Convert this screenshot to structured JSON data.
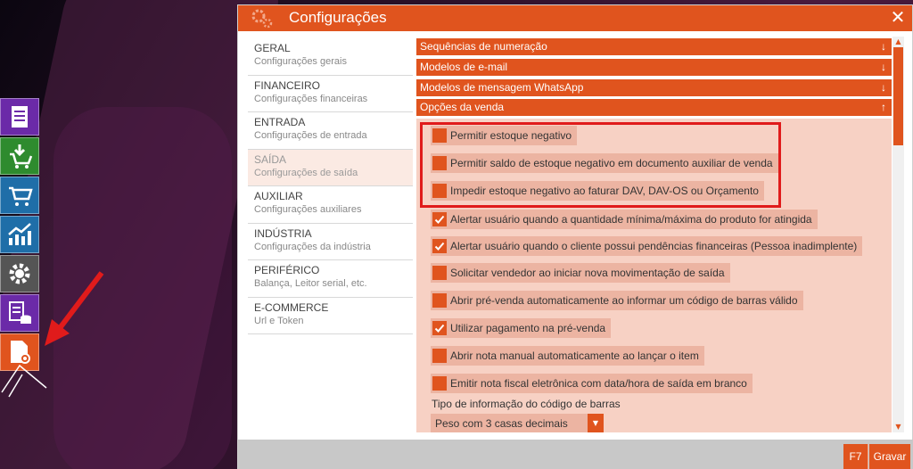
{
  "window": {
    "title": "Configurações"
  },
  "nav": [
    {
      "title": "GERAL",
      "subtitle": "Configurações gerais"
    },
    {
      "title": "FINANCEIRO",
      "subtitle": "Configurações financeiras"
    },
    {
      "title": "ENTRADA",
      "subtitle": "Configurações de entrada"
    },
    {
      "title": "SAÍDA",
      "subtitle": "Configurações de saída"
    },
    {
      "title": "AUXILIAR",
      "subtitle": "Configurações auxiliares"
    },
    {
      "title": "INDÚSTRIA",
      "subtitle": "Configurações da indústria"
    },
    {
      "title": "PERIFÉRICO",
      "subtitle": "Balança, Leitor serial, etc."
    },
    {
      "title": "E-COMMERCE",
      "subtitle": "Url e Token"
    }
  ],
  "sections": [
    {
      "label": "Sequências de numeração",
      "icon": "arrow-down-icon"
    },
    {
      "label": "Modelos de e-mail",
      "icon": "arrow-down-icon"
    },
    {
      "label": "Modelos de mensagem WhatsApp",
      "icon": "arrow-down-icon"
    },
    {
      "label": "Opções da venda",
      "icon": "arrow-up-icon"
    }
  ],
  "options": [
    {
      "label": "Permitir estoque negativo",
      "checked": false
    },
    {
      "label": "Permitir saldo de estoque negativo em documento auxiliar de venda",
      "checked": false
    },
    {
      "label": "Impedir estoque negativo ao faturar DAV, DAV-OS ou Orçamento",
      "checked": false
    },
    {
      "label": "Alertar usuário quando a quantidade mínima/máxima do produto for atingida",
      "checked": true
    },
    {
      "label": "Alertar usuário quando o cliente possui pendências financeiras (Pessoa inadimplente)",
      "checked": true
    },
    {
      "label": "Solicitar vendedor ao iniciar nova movimentação de saída",
      "checked": false
    },
    {
      "label": "Abrir pré-venda automaticamente ao informar um código de barras válido",
      "checked": false
    },
    {
      "label": "Utilizar pagamento na pré-venda",
      "checked": true
    },
    {
      "label": "Abrir nota manual automaticamente ao lançar o item",
      "checked": false
    },
    {
      "label": "Emitir nota fiscal eletrônica com data/hora de saída em branco",
      "checked": false
    }
  ],
  "barcode": {
    "label": "Tipo de informação do código de barras",
    "value": "Peso com 3 casas decimais"
  },
  "footer": {
    "shortcut": "F7",
    "save_label": "Gravar"
  },
  "colors": {
    "accent": "#e0541e",
    "highlight": "#e01b1b",
    "panel": "#f7d1c4"
  }
}
